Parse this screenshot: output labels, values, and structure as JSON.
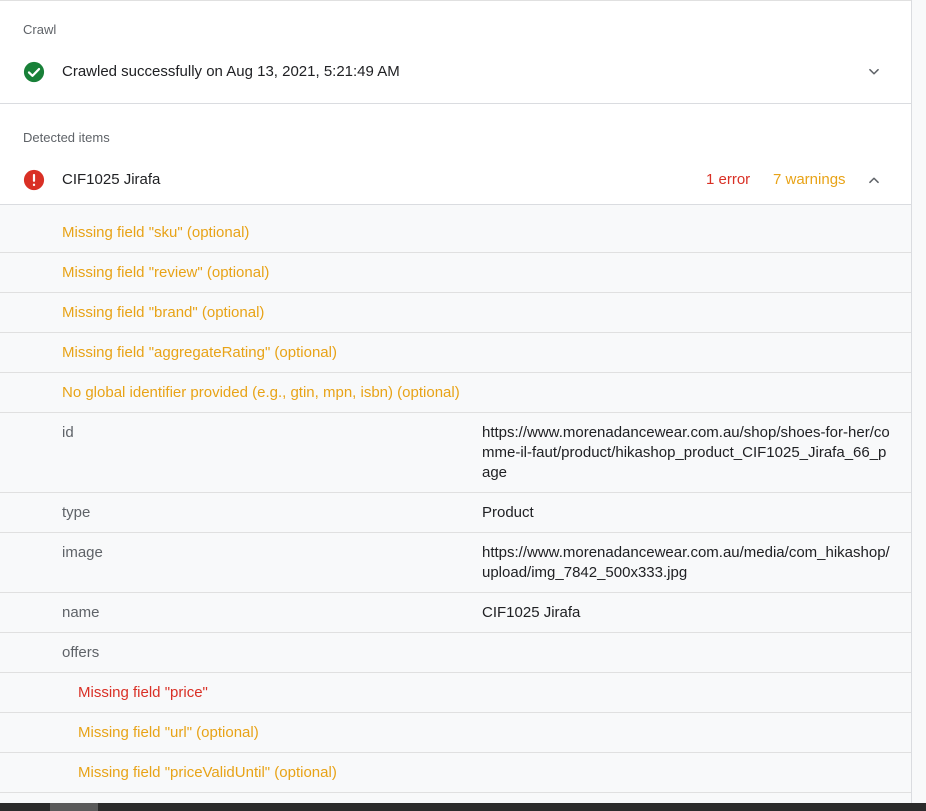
{
  "crawl": {
    "section_label": "Crawl",
    "status_text": "Crawled successfully on Aug 13, 2021, 5:21:49 AM",
    "status_icon": "check-circle-icon",
    "expand_icon": "chevron-down-icon"
  },
  "detected": {
    "section_label": "Detected items",
    "item_name": "CIF1025 Jirafa",
    "item_icon": "error-circle-icon",
    "error_count": "1 error",
    "warning_count": "7 warnings",
    "collapse_icon": "chevron-up-icon"
  },
  "issues": [
    "Missing field \"sku\" (optional)",
    "Missing field \"review\" (optional)",
    "Missing field \"brand\" (optional)",
    "Missing field \"aggregateRating\" (optional)",
    "No global identifier provided (e.g., gtin, mpn, isbn) (optional)"
  ],
  "properties": [
    {
      "key": "id",
      "value": "https://www.morenadancewear.com.au/shop/shoes-for-her/comme-il-faut/product/hikashop_product_CIF1025_Jirafa_66_page"
    },
    {
      "key": "type",
      "value": "Product"
    },
    {
      "key": "image",
      "value": "https://www.morenadancewear.com.au/media/com_hikashop/upload/img_7842_500x333.jpg"
    },
    {
      "key": "name",
      "value": "CIF1025 Jirafa"
    },
    {
      "key": "offers",
      "value": ""
    }
  ],
  "offer_issues": [
    {
      "text": "Missing field \"price\"",
      "severity": "error"
    },
    {
      "text": "Missing field \"url\" (optional)",
      "severity": "warning"
    },
    {
      "text": "Missing field \"priceValidUntil\" (optional)",
      "severity": "warning"
    }
  ],
  "colors": {
    "success": "#188038",
    "error": "#d93025",
    "warning": "#e8a317"
  }
}
